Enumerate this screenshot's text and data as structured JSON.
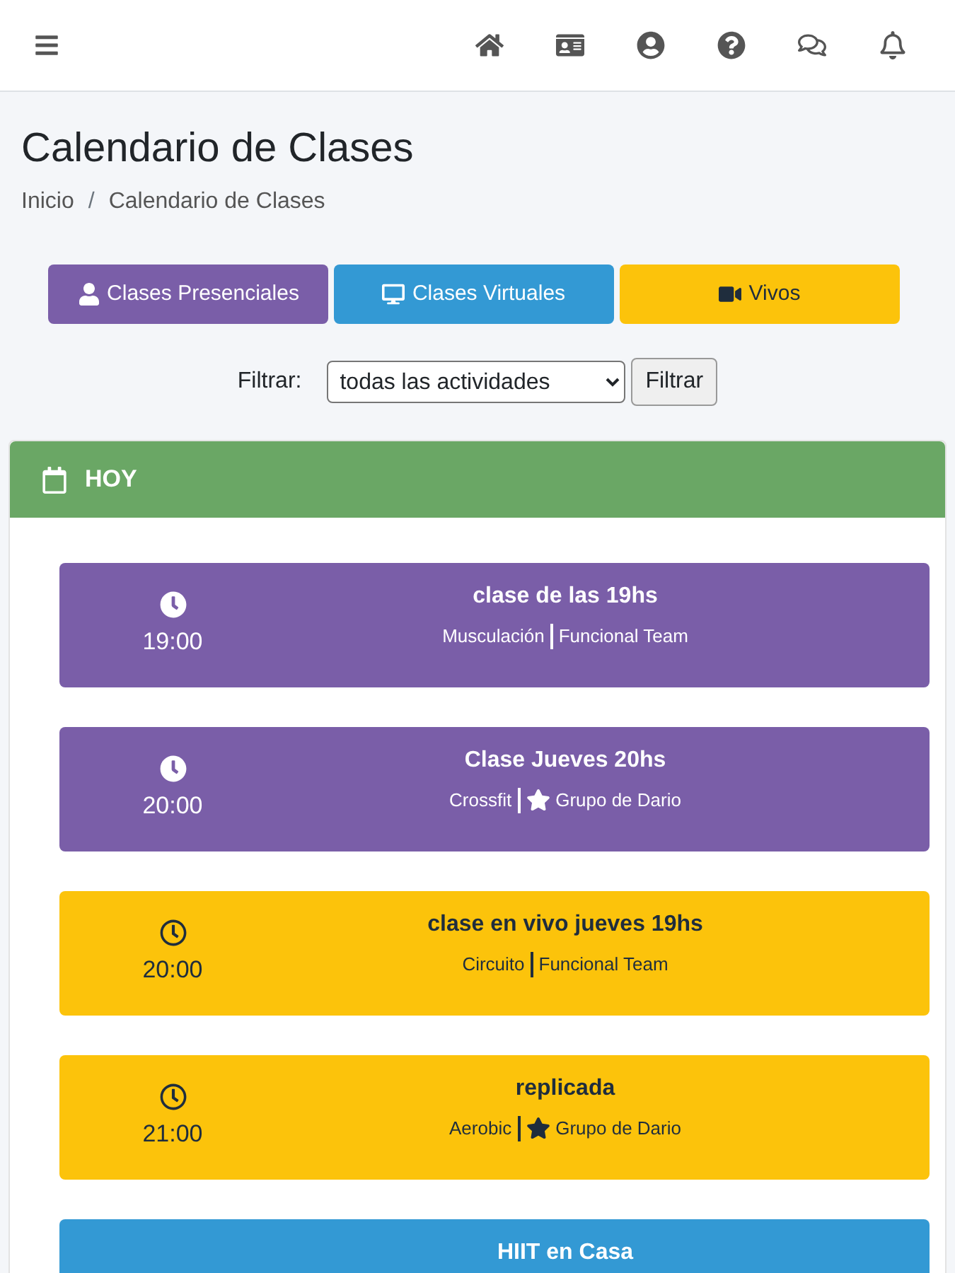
{
  "page_title": "Calendario de Clases",
  "breadcrumb": [
    "Inicio",
    "Calendario de Clases"
  ],
  "breadcrumb_separator": "/",
  "category_buttons": [
    {
      "label": "Clases Presenciales",
      "kind": "presencial"
    },
    {
      "label": "Clases Virtuales",
      "kind": "virtual"
    },
    {
      "label": "Vivos",
      "kind": "vivo"
    }
  ],
  "filter": {
    "label": "Filtrar:",
    "value": "todas las actividades",
    "button": "Filtrar"
  },
  "day_panel": {
    "title": "HOY",
    "classes": [
      {
        "kind": "presencial",
        "time": "19:00",
        "title": "clase de las 19hs",
        "activity": "Musculación",
        "group": "Funcional Team",
        "starred": false
      },
      {
        "kind": "presencial",
        "time": "20:00",
        "title": "Clase Jueves 20hs",
        "activity": "Crossfit",
        "group": "Grupo de Dario",
        "starred": true
      },
      {
        "kind": "vivo",
        "time": "20:00",
        "title": "clase en vivo jueves 19hs",
        "activity": "Circuito",
        "group": "Funcional Team",
        "starred": false
      },
      {
        "kind": "vivo",
        "time": "21:00",
        "title": "replicada",
        "activity": "Aerobic",
        "group": "Grupo de Dario",
        "starred": true
      },
      {
        "kind": "virtual",
        "title": "HIIT en Casa"
      }
    ]
  }
}
